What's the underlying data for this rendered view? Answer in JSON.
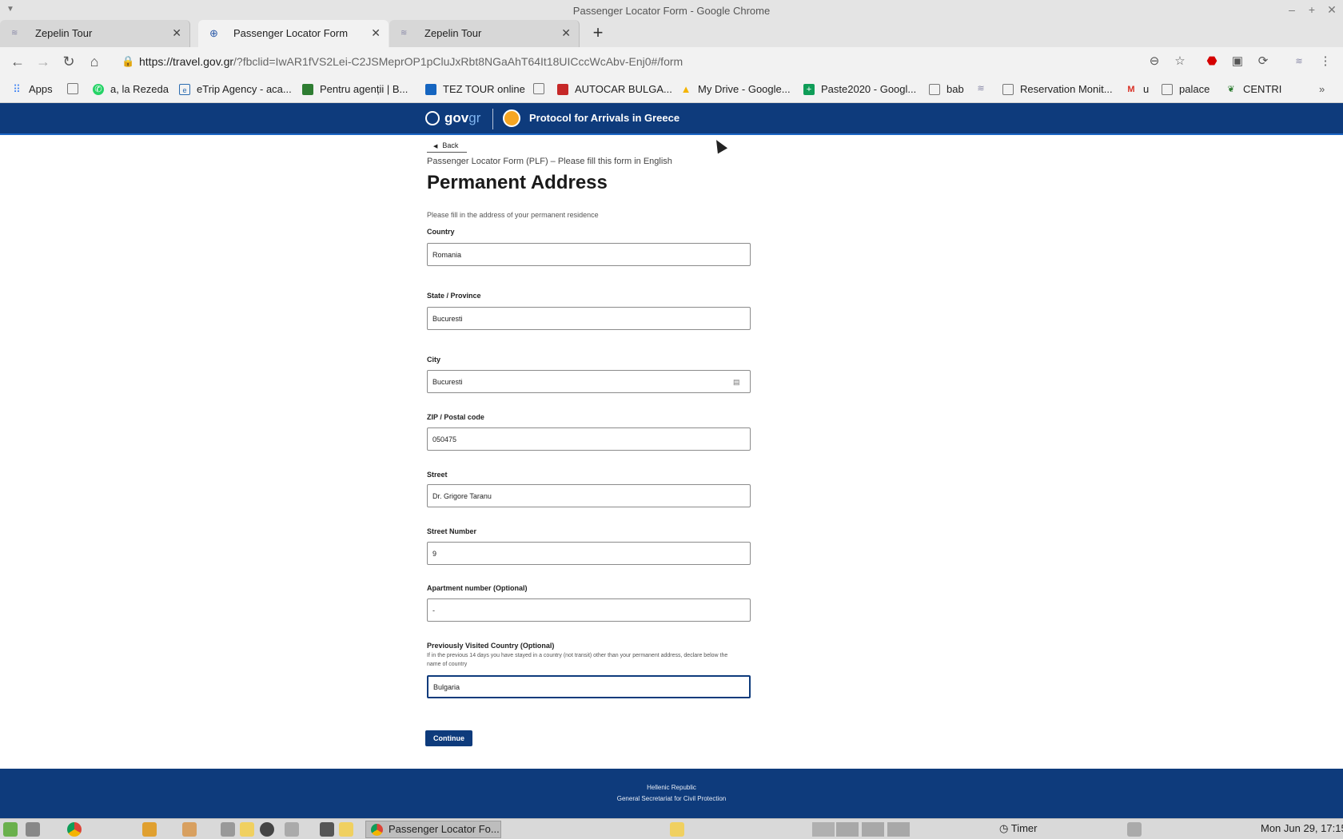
{
  "window": {
    "title": "Passenger Locator Form - Google Chrome"
  },
  "tabs": [
    {
      "label": "Zepelin Tour",
      "active": false
    },
    {
      "label": "Passenger Locator Form",
      "active": true
    },
    {
      "label": "Zepelin Tour",
      "active": false
    }
  ],
  "toolbar": {
    "url_host": "https://travel.gov.gr",
    "url_rest": "/?fbclid=IwAR1fVS2Lei-C2JSMeprOP1pCluJxRbt8NGaAhT64It18UICccWcAbv-Enj0#/form"
  },
  "bookmarks": [
    {
      "label": "Apps",
      "icon": "apps-grid-icon",
      "color": "#4285f4"
    },
    {
      "label": "",
      "icon": "page-icon",
      "color": "#666666"
    },
    {
      "label": "a, la Rezeda",
      "icon": "whatsapp-icon",
      "color": "#25d366"
    },
    {
      "label": "eTrip Agency - aca...",
      "icon": "etrip-icon",
      "color": "#2b6cb0"
    },
    {
      "label": "Pentru agenții | B...",
      "icon": "agency-icon",
      "color": "#2e7d32"
    },
    {
      "label": "TEZ TOUR online",
      "icon": "tez-tour-icon",
      "color": "#1565c0"
    },
    {
      "label": "",
      "icon": "page-icon",
      "color": "#666666"
    },
    {
      "label": "AUTOCAR BULGA...",
      "icon": "autocar-icon",
      "color": "#c62828"
    },
    {
      "label": "My Drive - Google...",
      "icon": "google-drive-icon",
      "color": "#f4b400"
    },
    {
      "label": "Paste2020 - Googl...",
      "icon": "google-sheets-icon",
      "color": "#0f9d58"
    },
    {
      "label": "bab",
      "icon": "page-icon",
      "color": "#666666"
    },
    {
      "label": "",
      "icon": "travel-icon",
      "color": "#8a8aa8"
    },
    {
      "label": "Reservation Monit...",
      "icon": "page-icon",
      "color": "#666666"
    },
    {
      "label": "u",
      "icon": "gmail-icon",
      "color": "#d93025"
    },
    {
      "label": "palace",
      "icon": "page-icon",
      "color": "#666666"
    },
    {
      "label": "CENTRI",
      "icon": "leaf-icon",
      "color": "#2e7d32"
    }
  ],
  "header": {
    "logo_main": "gov",
    "logo_accent": "gr",
    "title": "Protocol for Arrivals in Greece"
  },
  "form": {
    "back_label": "Back",
    "caption": "Passenger Locator Form (PLF) – Please fill this form in English",
    "page_title": "Permanent Address",
    "hint": "Please fill in the address of your permanent residence",
    "fields": {
      "country": {
        "label": "Country",
        "value": "Romania"
      },
      "state": {
        "label": "State / Province",
        "value": "Bucuresti"
      },
      "city": {
        "label": "City",
        "value": "Bucuresti"
      },
      "zip": {
        "label": "ZIP / Postal code",
        "value": "050475"
      },
      "street": {
        "label": "Street",
        "value": "Dr. Grigore Taranu"
      },
      "street_number": {
        "label": "Street Number",
        "value": "9"
      },
      "apartment": {
        "label": "Apartment number (Optional)",
        "value": "-"
      },
      "prev_country": {
        "label": "Previously Visited Country (Optional)",
        "hint": "If in the previous 14 days you have stayed in a country (not transit) other than your permanent address, declare below the name of country",
        "value": "Bulgaria"
      }
    },
    "continue_label": "Continue"
  },
  "footer": {
    "line1": "Hellenic Republic",
    "line2": "General Secretariat for Civil Protection"
  },
  "taskbar": {
    "task_label": "Passenger Locator Fo...",
    "timer_label": "Timer",
    "clock": "Mon Jun 29, 17:15"
  },
  "colors": {
    "brand": "#0e3b7c",
    "header_accent": "#1c66c4"
  }
}
